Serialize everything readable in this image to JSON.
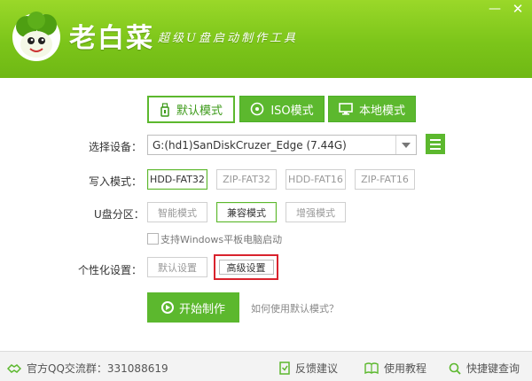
{
  "header": {
    "brand": "老白菜",
    "slogan": "超级U盘启动制作工具",
    "minimize_glyph": "—",
    "close_glyph": "✕",
    "colors": {
      "header_green": "#7cc51a",
      "accent_green": "#5cb82e",
      "highlight_red": "#d9232d"
    }
  },
  "tabs": [
    {
      "label": "默认模式",
      "icon": "usb-drive-icon",
      "selected": true
    },
    {
      "label": "ISO模式",
      "icon": "disc-icon",
      "selected": false
    },
    {
      "label": "本地模式",
      "icon": "monitor-icon",
      "selected": false
    }
  ],
  "device": {
    "label": "选择设备：",
    "value": "G:(hd1)SanDiskCruzer_Edge (7.44G)"
  },
  "write_mode": {
    "label": "写入模式：",
    "options": [
      "HDD-FAT32",
      "ZIP-FAT32",
      "HDD-FAT16",
      "ZIP-FAT16"
    ],
    "selected": "HDD-FAT32"
  },
  "partition": {
    "label": "U盘分区：",
    "options": [
      "智能模式",
      "兼容模式",
      "增强模式"
    ],
    "selected": "兼容模式"
  },
  "windows_tablet": {
    "label": "支持Windows平板电脑启动",
    "checked": false
  },
  "personalize": {
    "label": "个性化设置：",
    "default_btn": "默认设置",
    "advanced_btn": "高级设置"
  },
  "actions": {
    "start": "开始制作",
    "help": "如何使用默认模式？"
  },
  "footer": {
    "qq_group": "官方QQ交流群：331088619",
    "feedback": "反馈建议",
    "tutorial": "使用教程",
    "shortcut": "快捷键查询"
  }
}
